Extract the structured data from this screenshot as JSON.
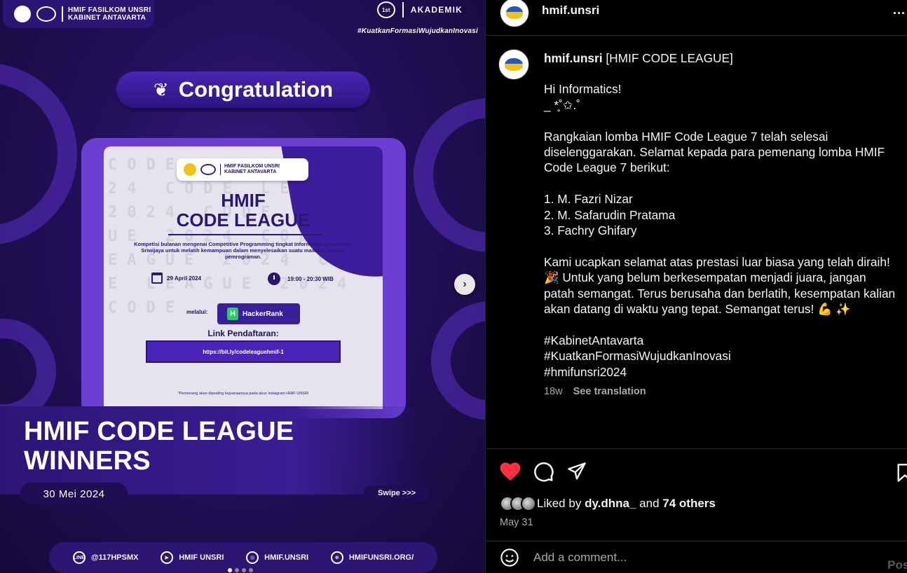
{
  "media": {
    "top_badge": [
      "HMIF FASILKOM UNSRI",
      "KABINET ANTAVARTA"
    ],
    "akademik": {
      "seal": "1st",
      "label": "AKADEMIK"
    },
    "hashtag": "#KuatkanFormasiWujudkanInovasi",
    "congrats": "Congratulation",
    "poster": {
      "badge": [
        "HMIF FASILKOM UNSRI",
        "KABINET ANTAVARTA"
      ],
      "title1": "HMIF",
      "title2": "CODE LEAGUE",
      "desc": "Kompetisi bulanan mengenai Competitive Programming tingkat Informatika Universitas Sriwijaya untuk melatih kemampuan dalam menyelesaikan suatu masalah dengan pemrograman.",
      "date": "29 April 2024",
      "time": "19:00 - 20:30 WIB",
      "via_label": "melalui:",
      "via": "HackerRank",
      "link_label": "Link Pendaftaran:",
      "link": "https://bit.ly/codeleaguehmif-1",
      "bg_text": "CODE LEAGUE 2024 CODE LEAGUE 2024 CODE LEAGUE 2024 CODE LEAGUE 2024 CODE LEAGUE 2024 CODE",
      "note": "*Pemenang akan diposting kejuaraannya pada akun instagram HMIF UNSRI"
    },
    "winners_line1": "HMIF CODE LEAGUE",
    "winners_line2": "WINNERS",
    "date": "30 Mei 2024",
    "swipe": "Swipe >>>",
    "socials": [
      {
        "icon": "LINE",
        "label": "@117HPSMX"
      },
      {
        "icon": "▶",
        "label": "HMIF UNSRI"
      },
      {
        "icon": "◎",
        "label": "HMIF.UNSRI"
      },
      {
        "icon": "⊕",
        "label": "HMIFUNSRI.ORG/"
      }
    ],
    "next": "›"
  },
  "header": {
    "username": "hmif.unsri",
    "more": "..."
  },
  "caption": {
    "username": "hmif.unsri",
    "title": "[HMIF CODE LEAGUE]",
    "lines": [
      "Hi Informatics!",
      "_ *̥˚✩.˚",
      "",
      "Rangkaian lomba HMIF Code League 7 telah selesai diselenggarakan. Selamat kepada para pemenang lomba HMIF Code League 7 berikut:",
      "",
      "1. M. Fazri Nizar",
      "2. M. Safarudin Pratama",
      "3. Fachry Ghifary",
      "",
      "Kami ucapkan selamat atas prestasi luar biasa yang telah diraih! 🎉 Untuk yang belum berkesempatan menjadi juara, jangan patah semangat. Terus berusaha dan berlatih, kesempatan kalian akan datang di waktu yang tepat. Semangat terus! 💪 ✨",
      "",
      "#KabinetAntavarta",
      "#KuatkanFormasiWujudkanInovasi",
      "#hmifunsri2024"
    ],
    "age": "18w",
    "see_translation": "See translation"
  },
  "likes": {
    "prefix": "Liked by",
    "user": "dy.dhna_",
    "and": "and",
    "others": "74 others"
  },
  "post_date": "May 31",
  "comment": {
    "placeholder": "Add a comment...",
    "post": "Post"
  },
  "colors": {
    "like": "#ff3040",
    "accent_purple": "#3b1f9a"
  }
}
